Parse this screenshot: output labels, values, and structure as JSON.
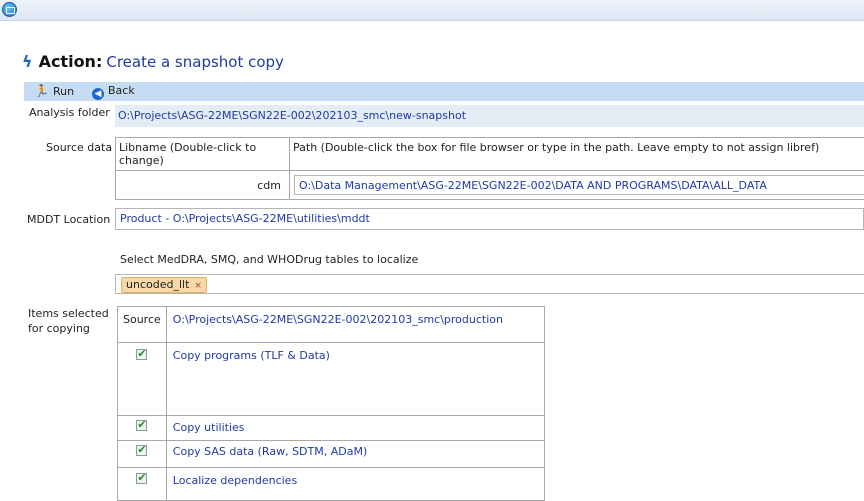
{
  "title": {
    "action": "Action",
    "colon": ":",
    "text": "Create a snapshot copy"
  },
  "toolbar": {
    "run_label": "Run",
    "back_label": "Back"
  },
  "analysis_folder": {
    "label": "Analysis folder",
    "value": "O:\\Projects\\ASG-22ME\\SGN22E-002\\202103_smc\\new-snapshot"
  },
  "source_data": {
    "label": "Source data",
    "col1_header": "Libname (Double-click to change)",
    "col2_header": "Path (Double-click the box for file browser or type in the path. Leave empty to not assign libref)",
    "rows": [
      {
        "libname": "cdm",
        "path": "O:\\Data Management\\ASG-22ME\\SGN22E-002\\DATA AND PROGRAMS\\DATA\\ALL_DATA"
      }
    ]
  },
  "mddt": {
    "label": "MDDT Location",
    "value": "Product - O:\\Projects\\ASG-22ME\\utilities\\mddt"
  },
  "localize": {
    "label": "Select MedDRA, SMQ, and WHODrug tables to localize",
    "chips": [
      "uncoded_llt"
    ],
    "chip_remove": "×"
  },
  "items": {
    "label_line1": "Items selected",
    "label_line2": "for copying",
    "source_label": "Source",
    "source_path": "O:\\Projects\\ASG-22ME\\SGN22E-002\\202103_smc\\production",
    "options": [
      {
        "label": "Copy programs (TLF & Data)",
        "checked": true
      },
      {
        "label": "Copy utilities",
        "checked": true
      },
      {
        "label": "Copy SAS data (Raw, SDTM, ADaM)",
        "checked": true
      },
      {
        "label": "Localize dependencies",
        "checked": true
      }
    ]
  },
  "icons": {
    "app": "app-icon",
    "action": "lightning-bolt-icon",
    "run": "running-man-icon",
    "back": "back-arrow-icon",
    "checkbox": "checkmark-icon"
  },
  "colors": {
    "accent": "#1e66c9",
    "link_text": "#1e3aa8",
    "toolbar_bg": "#c6dbf4",
    "field_bg": "#e4ecf6",
    "chip_bg": "#f7d9a8"
  }
}
